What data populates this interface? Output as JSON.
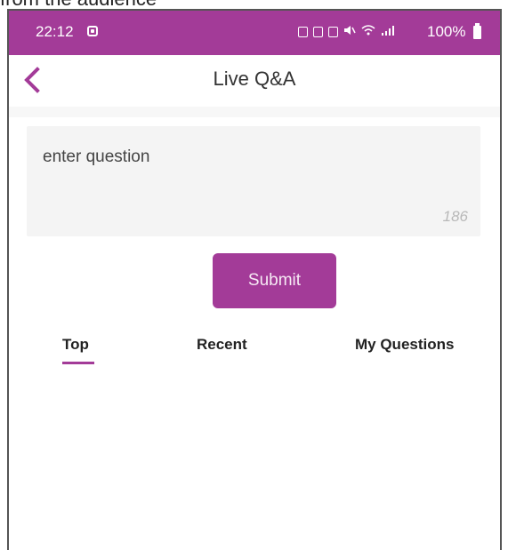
{
  "caption": "from the audience",
  "status_bar": {
    "time": "22:12",
    "battery_pct": "100%"
  },
  "app_bar": {
    "title": "Live Q&A"
  },
  "question": {
    "placeholder": "enter question",
    "char_count": "186"
  },
  "submit_label": "Submit",
  "tabs": [
    {
      "label": "Top",
      "selected": true
    },
    {
      "label": "Recent",
      "selected": false
    },
    {
      "label": "My Questions",
      "selected": false
    }
  ],
  "colors": {
    "accent": "#a33b98",
    "input_bg": "#f4f4f4"
  },
  "icons": [
    "back-chevron-icon",
    "notification-icon",
    "battery-icon"
  ]
}
